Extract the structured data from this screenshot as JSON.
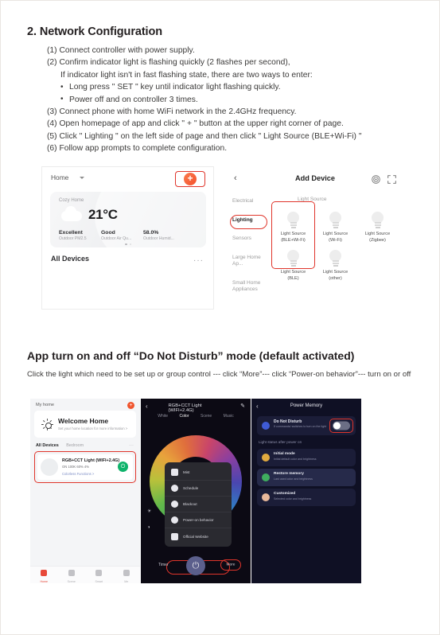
{
  "section1": {
    "title": "2. Network Configuration",
    "steps": [
      {
        "text": "(1) Connect controller with power supply.",
        "style": "normal"
      },
      {
        "text": "(2) Confirm indicator light is flashing quickly (2 flashes per second),",
        "style": "normal"
      },
      {
        "text": "If indicator light isn't in fast flashing state, there are two ways to enter:",
        "style": "indent1"
      },
      {
        "text": "Long press \" SET \" key until indicator light flashing quickly.",
        "style": "bullet"
      },
      {
        "text": "Power off and on controller 3 times.",
        "style": "bullet"
      },
      {
        "text": "(3) Connect phone with home WiFi network in the 2.4GHz frequency.",
        "style": "normal"
      },
      {
        "text": "(4) Open homepage of app and click \" + \" button at the upper right corner of page.",
        "style": "normal"
      },
      {
        "text": "(5) Click \" Lighting \" on the left side of page and then click \" Light Source (BLE+Wi-Fi) \"",
        "style": "normal"
      },
      {
        "text": "(6) Follow app prompts to complete configuration.",
        "style": "normal"
      }
    ]
  },
  "home_screenshot": {
    "home_label": "Home",
    "add_button_label": "+",
    "weather_card": {
      "home_name": "Cozy Home",
      "temperature": "21°C",
      "metrics": [
        {
          "value": "Excellent",
          "label": "Outdoor PM2.5"
        },
        {
          "value": "Good",
          "label": "Outdoor Air Qu..."
        },
        {
          "value": "58.0%",
          "label": "Outdoor Humid..."
        }
      ]
    },
    "all_devices_label": "All Devices",
    "overflow_label": "···"
  },
  "add_device_screenshot": {
    "back_label": "‹",
    "title": "Add Device",
    "icons": [
      "radar-icon",
      "scan-icon"
    ],
    "categories": [
      {
        "label": "Electrical",
        "active": false
      },
      {
        "label": "Lighting",
        "active": true
      },
      {
        "label": "Sensors",
        "active": false
      },
      {
        "label": "Large Home Ap...",
        "active": false
      },
      {
        "label": "Small Home Appliances",
        "active": false
      }
    ],
    "group_label": "Light Source",
    "devices": [
      {
        "line1": "Light Source",
        "line2": "(BLE+Wi-Fi)",
        "highlighted": true
      },
      {
        "line1": "Light Source",
        "line2": "(Wi-Fi)",
        "highlighted": false
      },
      {
        "line1": "Light Source",
        "line2": "(Zigbee)",
        "highlighted": false
      },
      {
        "line1": "Light Source",
        "line2": "(BLE)",
        "highlighted": false
      },
      {
        "line1": "Light Source",
        "line2": "(other)",
        "highlighted": false
      }
    ]
  },
  "section2": {
    "title": "App turn on and off “Do Not Disturb” mode (default activated)",
    "description": "Click the light which need to be set up or group control --- click “More”--- click “Power-on behavior”--- turn on or off"
  },
  "phone1": {
    "home_label": "My home",
    "add_label": "+",
    "welcome_title": "Welcome Home",
    "welcome_sub": "Set your home location for more information  >",
    "tab_all": "All Devices",
    "tab_bedroom": "Bedroom",
    "overflow": "···",
    "device": {
      "name": "RGB+CCT Light (WIFI+2.4G)",
      "status": "ON    100K    60%    4%",
      "link": "Colorless Functions  >",
      "power_icon": "⏻"
    },
    "nav": [
      {
        "label": "Home",
        "active": true,
        "icon": "home-icon"
      },
      {
        "label": "Scene",
        "active": false,
        "icon": "scene-icon"
      },
      {
        "label": "Smart",
        "active": false,
        "icon": "smart-icon"
      },
      {
        "label": "Me",
        "active": false,
        "icon": "profile-icon"
      }
    ]
  },
  "phone2": {
    "back_label": "‹",
    "title": "RGB+CCT Light (WIFI+2.4G)",
    "edit_icon": "✎",
    "tabs": [
      {
        "label": "White",
        "active": false
      },
      {
        "label": "Color",
        "active": true
      },
      {
        "label": "Scene",
        "active": false
      },
      {
        "label": "Music",
        "active": false
      }
    ],
    "menu": [
      {
        "label": "Mist",
        "icon": "mist-icon",
        "highlighted": false
      },
      {
        "label": "Schedule",
        "icon": "clock-icon",
        "highlighted": false
      },
      {
        "label": "Blackout",
        "icon": "blackout-icon",
        "highlighted": false
      },
      {
        "label": "Power-on behavior",
        "icon": "power-icon",
        "highlighted": true
      },
      {
        "label": "Official Website",
        "icon": "web-icon",
        "highlighted": false
      }
    ],
    "sliders": [
      "☀",
      "◑"
    ],
    "timer_label": "Timer",
    "power_label": "⏻",
    "more_label": "More"
  },
  "phone3": {
    "back_label": "‹",
    "title": "Power Memory",
    "dnd": {
      "name": "Do Not Disturb",
      "desc": "If commands/ switches to turn on the light",
      "toggle_on": true
    },
    "section_label": "Light status after power on",
    "options": [
      {
        "name": "Initial mode",
        "desc": "Initial default color and brightness",
        "color": "#e0a93f",
        "selected": false
      },
      {
        "name": "Restore memory",
        "desc": "Last used color and brightness",
        "color": "#3fae5f",
        "selected": true
      },
      {
        "name": "Customized",
        "desc": "Selected color and brightness",
        "color": "#e8b89a",
        "selected": false
      }
    ]
  },
  "colors": {
    "accent_red": "#e0352b",
    "orange": "#f0552e",
    "green": "#0fb36b"
  }
}
